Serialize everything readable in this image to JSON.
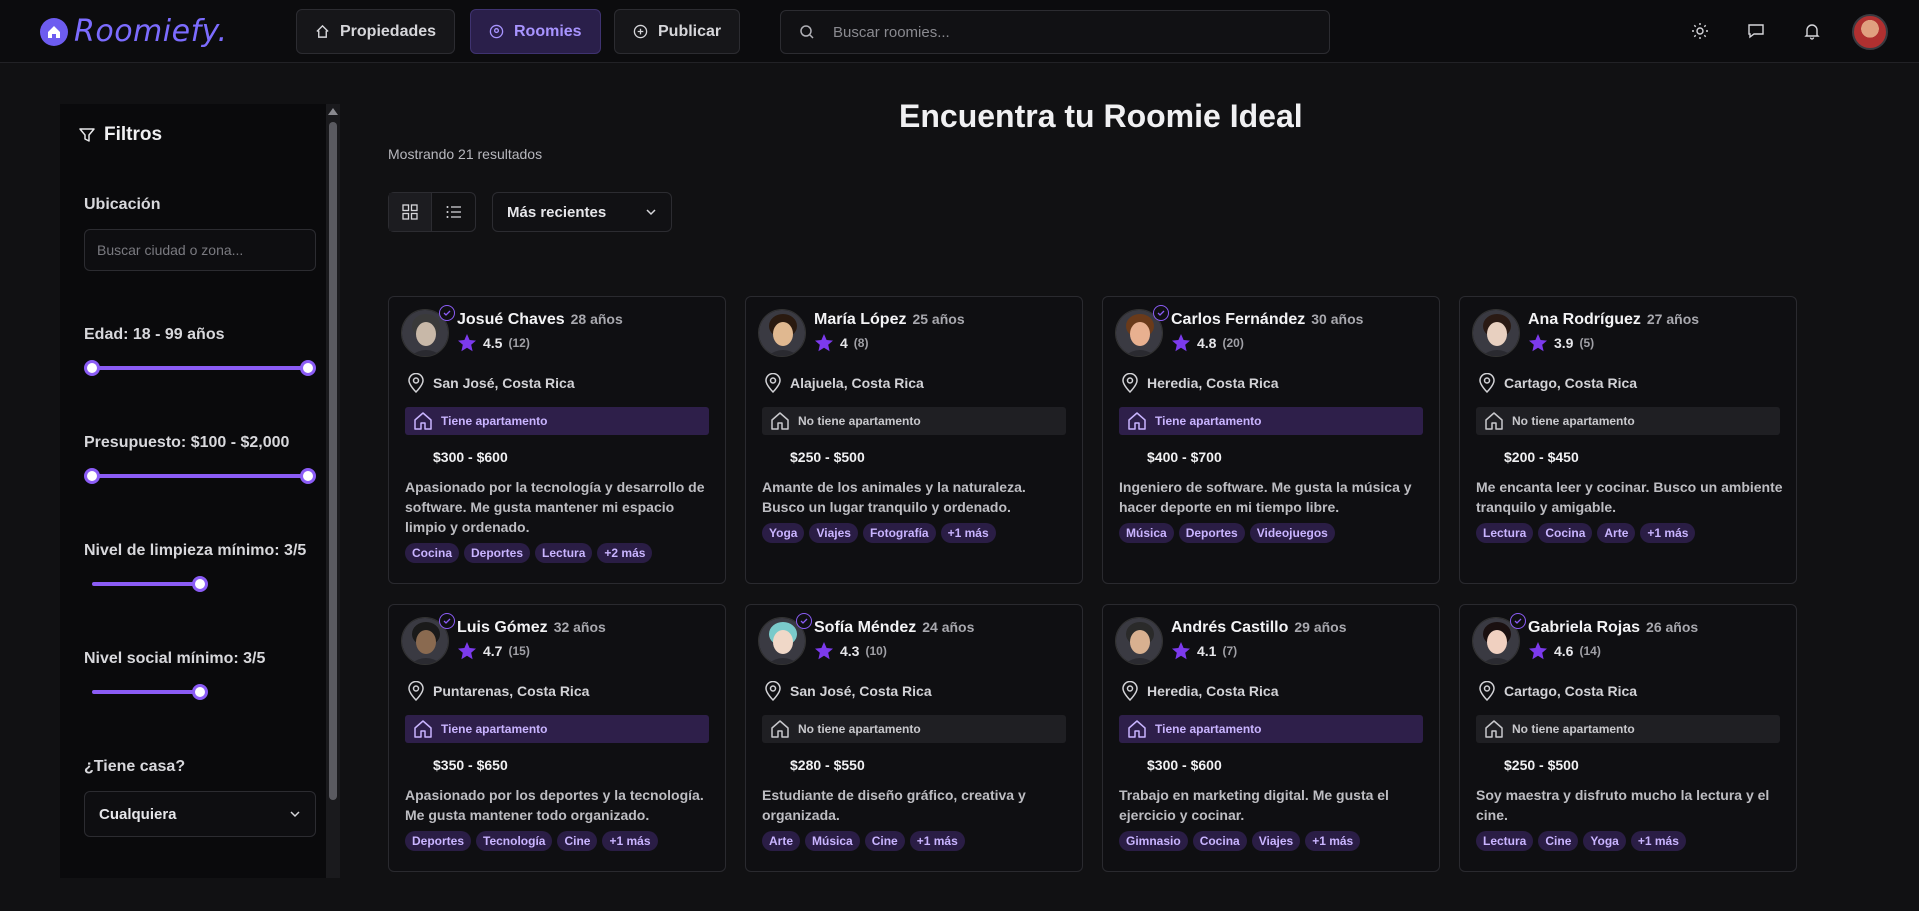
{
  "header": {
    "logo_text": "Roomiefy.",
    "nav": [
      {
        "label": "Propiedades",
        "icon": "home-icon"
      },
      {
        "label": "Roomies",
        "icon": "user-circle-icon"
      },
      {
        "label": "Publicar",
        "icon": "plus-circle-icon"
      }
    ],
    "search_placeholder": "Buscar roomies...",
    "icons": [
      "sun-icon",
      "message-icon",
      "bell-icon"
    ]
  },
  "filters": {
    "title": "Filtros",
    "location_label": "Ubicación",
    "location_placeholder": "Buscar ciudad o zona...",
    "age_label": "Edad: 18 - 99 años",
    "age_range": [
      18,
      99
    ],
    "budget_label": "Presupuesto: $100 - $2,000",
    "budget_range": [
      100,
      2000
    ],
    "cleanliness_label": "Nivel de limpieza mínimo: 3/5",
    "cleanliness_value": 3,
    "social_label": "Nivel social mínimo: 3/5",
    "social_value": 3,
    "house_label": "¿Tiene casa?",
    "house_value": "Cualquiera"
  },
  "main": {
    "title": "Encuentra tu Roomie Ideal",
    "results": "Mostrando 21 resultados",
    "sort_value": "Más recientes"
  },
  "colors": {
    "accent": "#8b5cf6",
    "background": "#111113",
    "card": "#0f0f12"
  },
  "cards": [
    {
      "name": "Josué Chaves",
      "age": "28 años",
      "rating": "4.5",
      "reviews": "(12)",
      "verified": true,
      "location": "San José, Costa Rica",
      "home": "Tiene apartamento",
      "has_home": true,
      "price": "$300 - $600",
      "desc": "Apasionado por la tecnología y desarrollo de software. Me gusta mantener mi espacio limpio y ordenado.",
      "tags": [
        "Cocina",
        "Deportes",
        "Lectura",
        "+2 más"
      ],
      "skin": "#c8b8a8",
      "hair": "#3a3a3a"
    },
    {
      "name": "María López",
      "age": "25 años",
      "rating": "4",
      "reviews": "(8)",
      "verified": false,
      "location": "Alajuela, Costa Rica",
      "home": "No tiene apartamento",
      "has_home": false,
      "price": "$250 - $500",
      "desc": "Amante de los animales y la naturaleza. Busco un lugar tranquilo y ordenado.",
      "tags": [
        "Yoga",
        "Viajes",
        "Fotografía",
        "+1 más"
      ],
      "skin": "#e0b890",
      "hair": "#2a1a10"
    },
    {
      "name": "Carlos Fernández",
      "age": "30 años",
      "rating": "4.8",
      "reviews": "(20)",
      "verified": true,
      "location": "Heredia, Costa Rica",
      "home": "Tiene apartamento",
      "has_home": true,
      "price": "$400 - $700",
      "desc": "Ingeniero de software. Me gusta la música y hacer deporte en mi tiempo libre.",
      "tags": [
        "Música",
        "Deportes",
        "Videojuegos"
      ],
      "skin": "#e8b090",
      "hair": "#6a3a1a"
    },
    {
      "name": "Ana Rodríguez",
      "age": "27 años",
      "rating": "3.9",
      "reviews": "(5)",
      "verified": false,
      "location": "Cartago, Costa Rica",
      "home": "No tiene apartamento",
      "has_home": false,
      "price": "$200 - $450",
      "desc": "Me encanta leer y cocinar. Busco un ambiente tranquilo y amigable.",
      "tags": [
        "Lectura",
        "Cocina",
        "Arte",
        "+1 más"
      ],
      "skin": "#e8d0c0",
      "hair": "#2a1a14"
    },
    {
      "name": "Luis Gómez",
      "age": "32 años",
      "rating": "4.7",
      "reviews": "(15)",
      "verified": true,
      "location": "Puntarenas, Costa Rica",
      "home": "Tiene apartamento",
      "has_home": true,
      "price": "$350 - $650",
      "desc": "Apasionado por los deportes y la tecnología. Me gusta mantener todo organizado.",
      "tags": [
        "Deportes",
        "Tecnología",
        "Cine",
        "+1 más"
      ],
      "skin": "#8a6a50",
      "hair": "#1a1a1a"
    },
    {
      "name": "Sofía Méndez",
      "age": "24 años",
      "rating": "4.3",
      "reviews": "(10)",
      "verified": true,
      "location": "San José, Costa Rica",
      "home": "No tiene apartamento",
      "has_home": false,
      "price": "$280 - $550",
      "desc": "Estudiante de diseño gráfico, creativa y organizada.",
      "tags": [
        "Arte",
        "Música",
        "Cine",
        "+1 más"
      ],
      "skin": "#f0d8c8",
      "hair": "#7acaca"
    },
    {
      "name": "Andrés Castillo",
      "age": "29 años",
      "rating": "4.1",
      "reviews": "(7)",
      "verified": false,
      "location": "Heredia, Costa Rica",
      "home": "Tiene apartamento",
      "has_home": true,
      "price": "$300 - $600",
      "desc": "Trabajo en marketing digital. Me gusta el ejercicio y cocinar.",
      "tags": [
        "Gimnasio",
        "Cocina",
        "Viajes",
        "+1 más"
      ],
      "skin": "#d8b090",
      "hair": "#2a2a2a"
    },
    {
      "name": "Gabriela Rojas",
      "age": "26 años",
      "rating": "4.6",
      "reviews": "(14)",
      "verified": true,
      "location": "Cartago, Costa Rica",
      "home": "No tiene apartamento",
      "has_home": false,
      "price": "$250 - $500",
      "desc": "Soy maestra y disfruto mucho la lectura y el cine.",
      "tags": [
        "Lectura",
        "Cine",
        "Yoga",
        "+1 más"
      ],
      "skin": "#f0d0c0",
      "hair": "#1a1010"
    }
  ]
}
